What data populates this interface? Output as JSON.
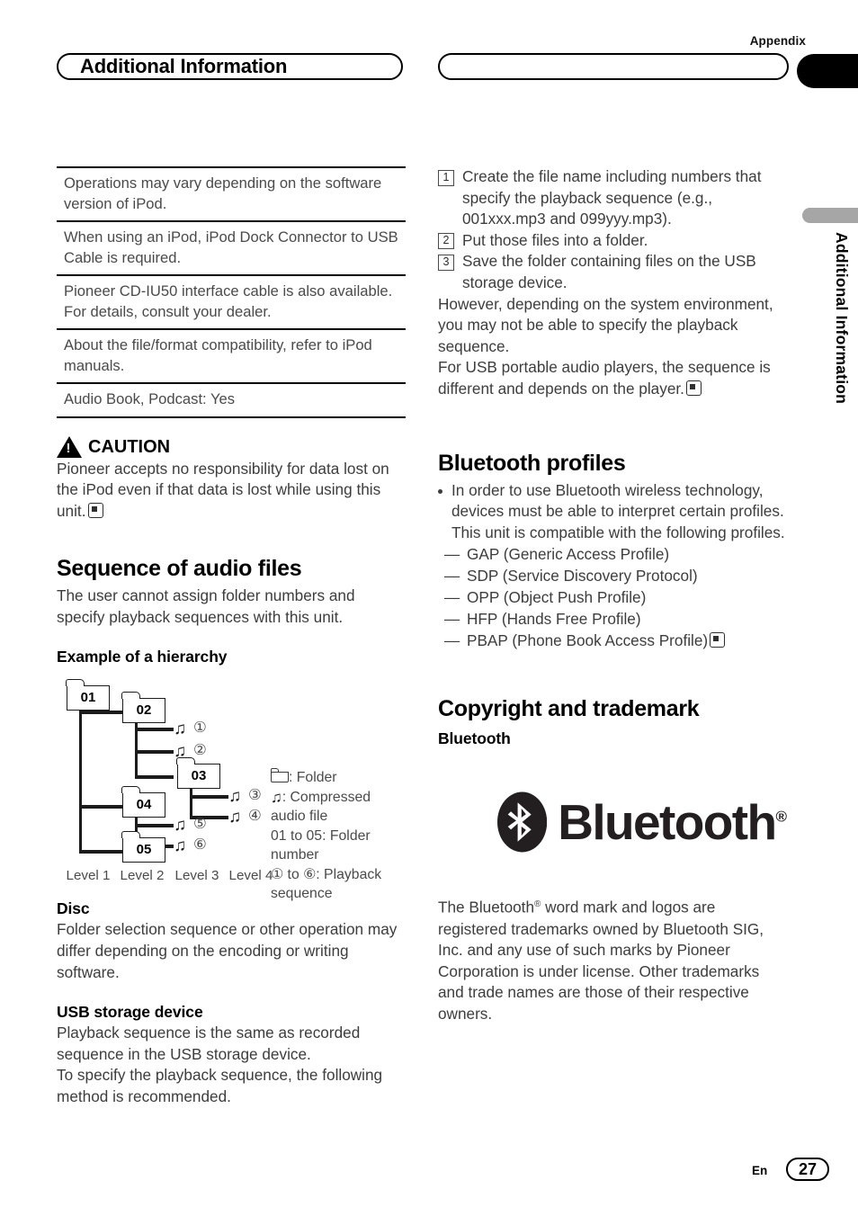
{
  "header": {
    "appendix_label": "Appendix",
    "chapter_pill_title": "Additional Information",
    "side_tab_text": "Additional Information"
  },
  "left_column": {
    "spec_table": {
      "rows": [
        "Operations may vary depending on the software version of iPod.",
        "When using an iPod, iPod Dock Connector to USB Cable is required.",
        "Pioneer CD-IU50 interface cable is also available. For details, consult your dealer.",
        "About the file/format compatibility, refer to iPod manuals.",
        "Audio Book, Podcast: Yes"
      ]
    },
    "caution": {
      "label": "CAUTION",
      "icon": "warning-triangle-icon",
      "text": "Pioneer accepts no responsibility for data lost on the iPod even if that data is lost while using this unit.",
      "end_marker": "end-of-section-marker"
    },
    "sequence_section": {
      "title": "Sequence of audio files",
      "intro": "The user cannot assign folder numbers and specify playback sequences with this unit.",
      "hierarchy_title": "Example of a hierarchy",
      "diagram": {
        "folders": [
          "01",
          "02",
          "03",
          "04",
          "05"
        ],
        "playback_numbers": [
          "①",
          "②",
          "③",
          "④",
          "⑤",
          "⑥"
        ],
        "level_labels": [
          "Level 1",
          "Level 2",
          "Level 3",
          "Level 4"
        ],
        "legend": {
          "folder": ": Folder",
          "compressed": ": Compressed audio file",
          "folder_number": "01 to 05: Folder number",
          "playback_sequence": "① to ⑥: Playback sequence"
        }
      }
    },
    "disc_section": {
      "title": "Disc",
      "text": "Folder selection sequence or other operation may differ depending on the encoding or writing software."
    },
    "usb_section": {
      "title": "USB storage device",
      "text_1": "Playback sequence is the same as recorded sequence in the USB storage device.",
      "text_2": "To specify the playback sequence, the following method is recommended."
    }
  },
  "right_column": {
    "steps": [
      {
        "num": "1",
        "text": "Create the file name including numbers that specify the playback sequence (e.g., 001xxx.mp3 and 099yyy.mp3)."
      },
      {
        "num": "2",
        "text": "Put those files into a folder."
      },
      {
        "num": "3",
        "text": "Save the folder containing files on the USB storage device."
      }
    ],
    "after_steps_1": "However, depending on the system environment, you may not be able to specify the playback sequence.",
    "after_steps_2": "For USB portable audio players, the sequence is different and depends on the player.",
    "bluetooth_profiles": {
      "title": "Bluetooth profiles",
      "bullet": "In order to use Bluetooth wireless technology, devices must be able to interpret certain profiles. This unit is compatible with the following profiles.",
      "profiles": [
        "GAP (Generic Access Profile)",
        "SDP (Service Discovery Protocol)",
        "OPP (Object Push Profile)",
        "HFP (Hands Free Profile)",
        "PBAP (Phone Book Access Profile)"
      ]
    },
    "copyright": {
      "title": "Copyright and trademark",
      "subtitle": "Bluetooth",
      "logo_wordmark": "Bluetooth",
      "logo_registered": "®",
      "body_part_1": "The Bluetooth",
      "body_part_2": " word mark and logos are registered trademarks owned by Bluetooth SIG, Inc. and any use of such marks by Pioneer Corporation is under license. Other trademarks and trade names are those of their respective owners."
    }
  },
  "footer": {
    "language": "En",
    "page_number": "27"
  },
  "colors": {
    "text": "#3d3d3d",
    "heading": "#000000",
    "rule": "#000000",
    "side_tab_gray": "#a6a6a6",
    "logo": "#231f20"
  }
}
